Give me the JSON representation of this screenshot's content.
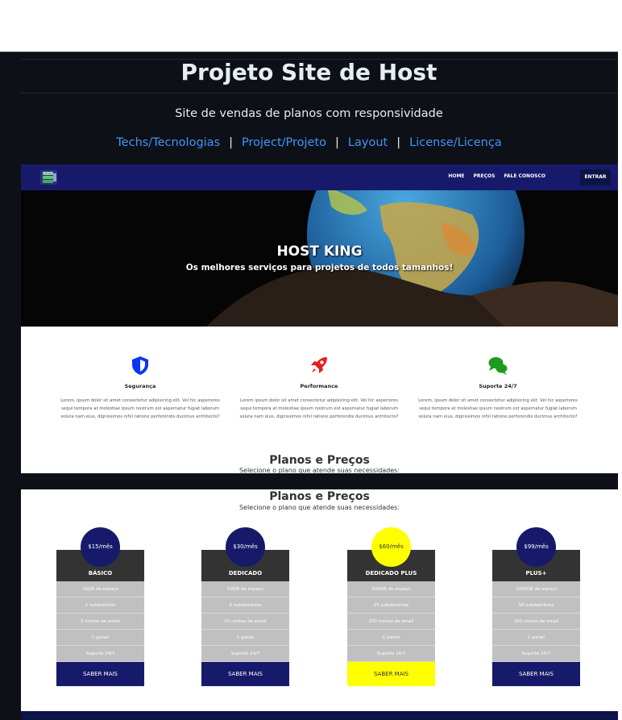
{
  "readme": {
    "title": "Projeto Site de Host",
    "subtitle": "Site de vendas de planos com responsividade",
    "links": [
      "Techs/Tecnologias",
      "Project/Projeto",
      "Layout",
      "License/Licença"
    ],
    "separator": "|"
  },
  "site": {
    "nav": {
      "items": [
        "HOME",
        "PREÇOS",
        "FALE CONOSCO"
      ],
      "login_label": "ENTRAR",
      "logo_icon": "server-stack-icon"
    },
    "hero": {
      "title": "HOST KING",
      "subtitle": "Os melhores serviços para projetos de todos tamanhos!"
    },
    "features": [
      {
        "icon": "shield-icon",
        "color": "#0b35f0",
        "name": "Segurança",
        "text": "Lorem, ipsum dolor sit amet consectetur adipisicing elit. Vel hic asperiores sequi tempora at molestiae ipsum nostrum est aspernatur fugiat laborum soluta nam eius, dignissimos nihil ratione perferendis ducimus architecto?"
      },
      {
        "icon": "rocket-icon",
        "color": "#e51f1f",
        "name": "Performance",
        "text": "Lorem ipsum dolor sit amet consectetur adipisicing elit. Vel hic asperiores sequi tempora at molestiae ipsum nostrum est aspernatur fugiat laborum soluta nam eius, dignissimos nihil ratione perferendis ducimus architecto?"
      },
      {
        "icon": "chat-bubbles-icon",
        "color": "#1f9a1f",
        "name": "Suporte 24/7",
        "text": "Lorem, ipsum dolor sit amet consectetur adipisicing elit. Vel hic asperiores sequi tempora at molestiae ipsum nostrum est aspernatur fugiat laborum soluta nam eius, dignissimos nihil ratione perferendis ducimus architecto?"
      }
    ],
    "pricing": {
      "title": "Planos e Preços",
      "subtitle": "Selecione o plano que atende suas necessidades:"
    },
    "plans": [
      {
        "price": "$15/mês",
        "name": "BÁSICO",
        "color": "#171a6b",
        "text_color": "#ffffff",
        "features": [
          "20GB de espaço",
          "1 subdomínio",
          "5 contas de email",
          "C-panel",
          "Suporte 24/7"
        ],
        "button": "SABER MAIS"
      },
      {
        "price": "$30/mês",
        "name": "DEDICADO",
        "color": "#171a6b",
        "text_color": "#ffffff",
        "features": [
          "50GB de espaço",
          "5 subdomínios",
          "20 contas de email",
          "C-panel",
          "Suporte 24/7"
        ],
        "button": "SABER MAIS"
      },
      {
        "price": "$60/mês",
        "name": "DEDICADO PLUS",
        "color": "#ffff00",
        "text_color": "#333333",
        "features": [
          "500GB de espaço",
          "25 subdomínios",
          "100 contas de email",
          "C-panel",
          "Suporte 24/7"
        ],
        "button": "SABER MAIS"
      },
      {
        "price": "$99/mês",
        "name": "PLUS+",
        "color": "#171a6b",
        "text_color": "#ffffff",
        "features": [
          "1000GB de espaço",
          "50 subdomínios",
          "200 contas de email",
          "C-panel",
          "Suporte 24/7"
        ],
        "button": "SABER MAIS"
      }
    ]
  }
}
